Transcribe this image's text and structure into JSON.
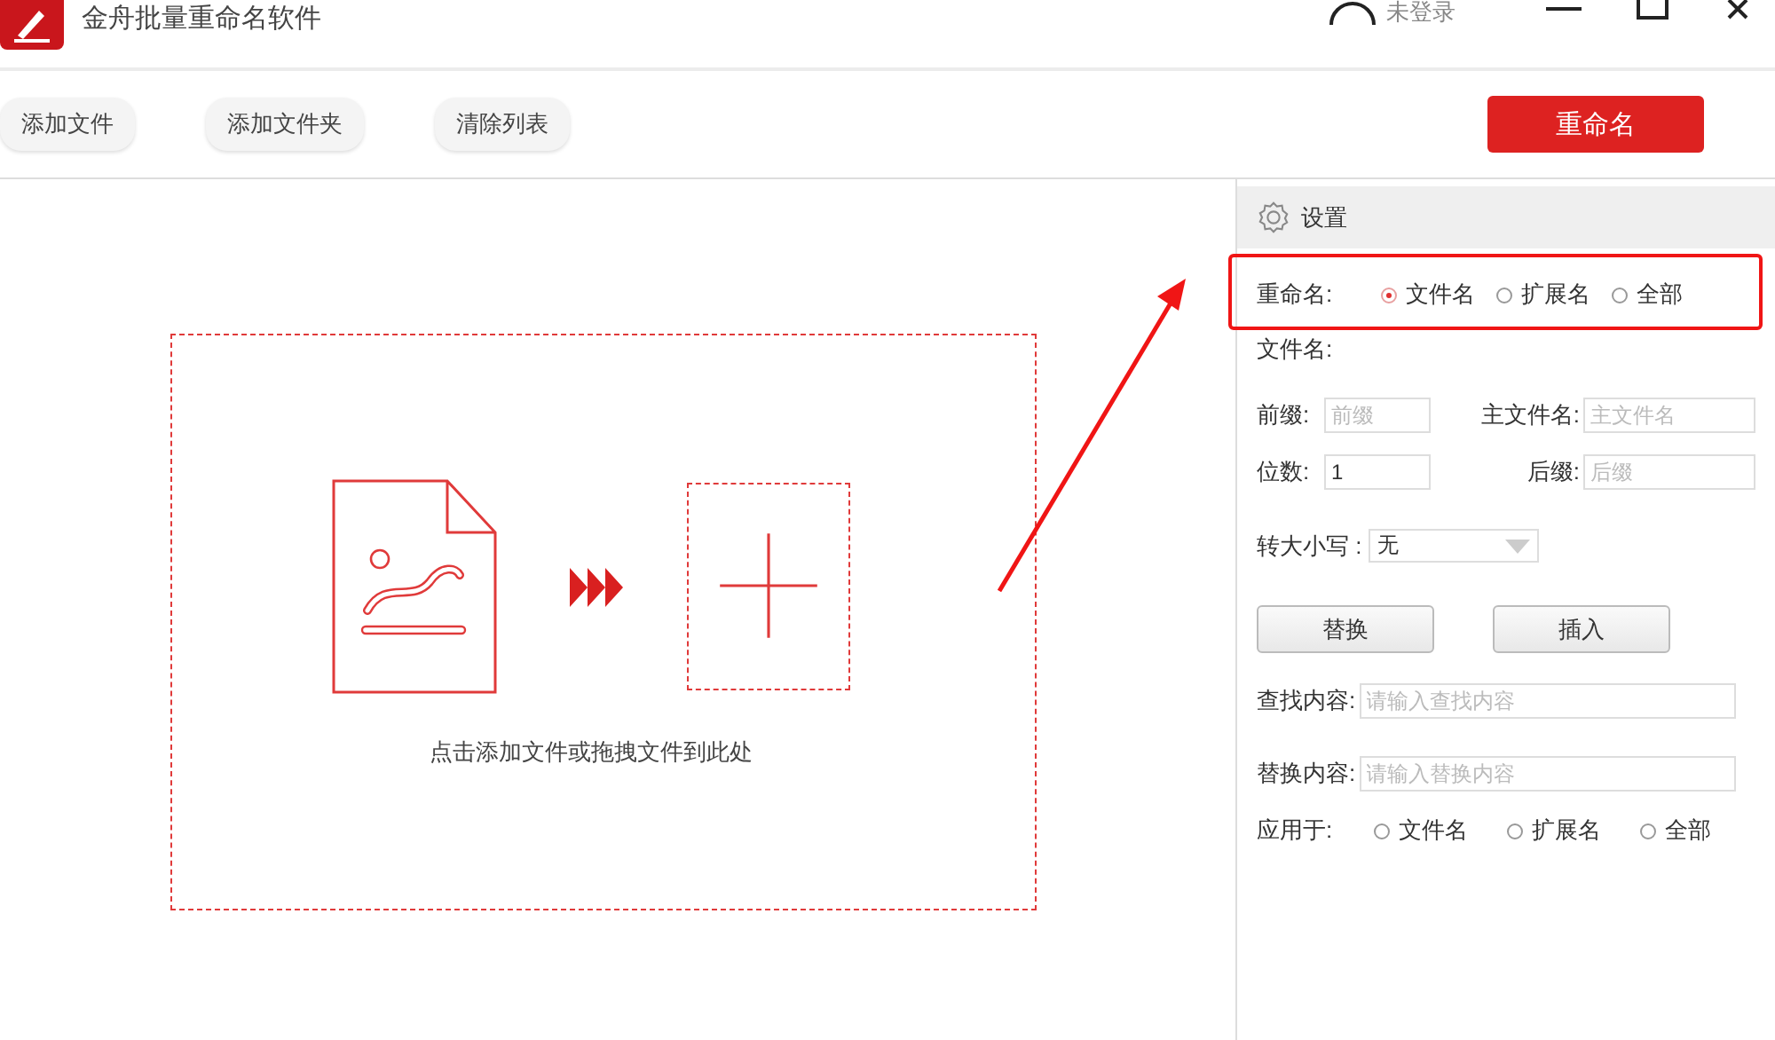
{
  "window": {
    "title": "金舟批量重命名软件",
    "user": "未登录"
  },
  "toolbar": {
    "buttons": [
      "添加文件",
      "添加文件夹",
      "清除列表"
    ],
    "primary_button": "重命名"
  },
  "drop_area": {
    "hint": "点击添加文件或拖拽文件到此处"
  },
  "settings": {
    "title": "设置",
    "rename_target": {
      "label": "重命名:",
      "options": [
        {
          "label": "文件名",
          "selected": true
        },
        {
          "label": "扩展名",
          "selected": false
        },
        {
          "label": "全部",
          "selected": false
        }
      ]
    },
    "filename_label": "文件名:",
    "fields": [
      {
        "label": "前缀:",
        "placeholder": "前缀"
      },
      {
        "label": "主文件名:",
        "placeholder": "主文件名"
      },
      {
        "label": "位数:",
        "value": "1"
      },
      {
        "label": "后缀:",
        "placeholder": "后缀"
      }
    ],
    "case": {
      "label": "转大小写 :",
      "value": "无"
    },
    "buttons": [
      "替换",
      "插入"
    ],
    "find": {
      "label": "查找内容:",
      "placeholder": "请输入查找内容"
    },
    "replace": {
      "label": "替换内容:",
      "placeholder": "请输入替换内容"
    },
    "apply_to": {
      "label": "应用于:",
      "options": [
        {
          "label": "文件名",
          "selected": false
        },
        {
          "label": "扩展名",
          "selected": false
        },
        {
          "label": "全部",
          "selected": false
        }
      ]
    }
  }
}
